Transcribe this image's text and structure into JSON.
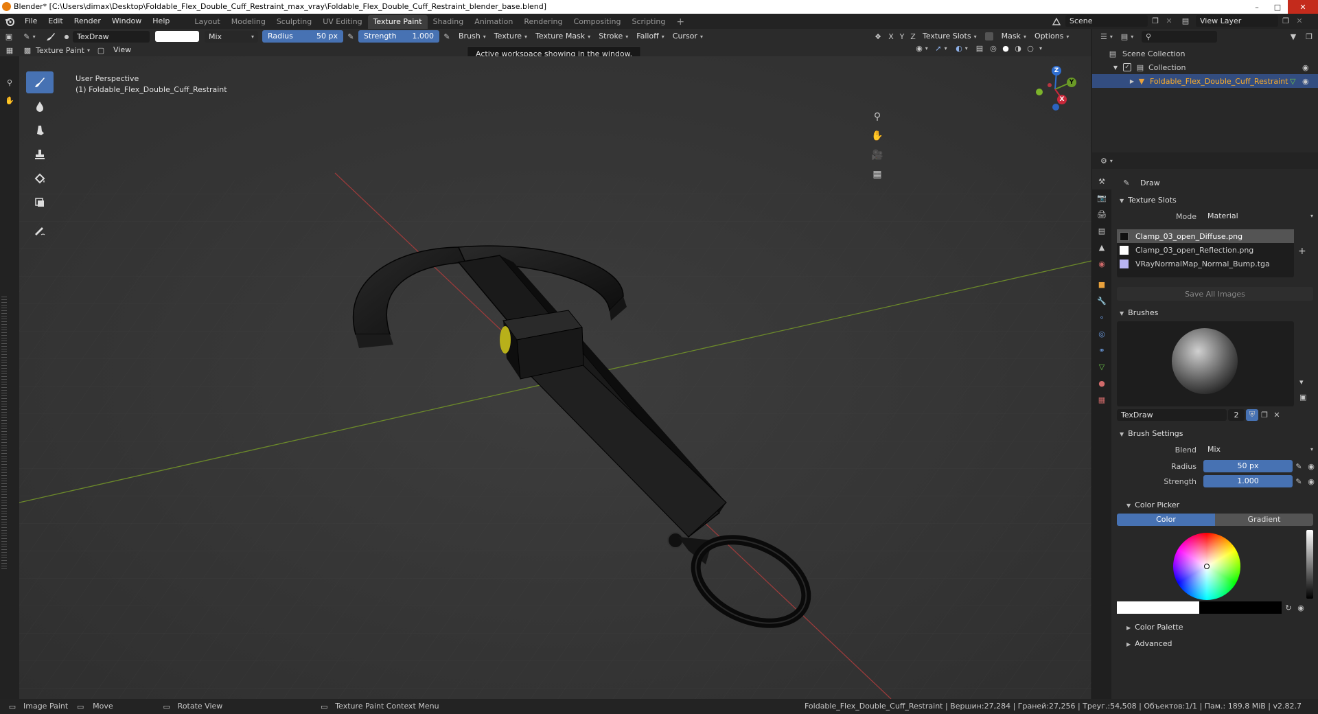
{
  "titlebar": {
    "title": "Blender* [C:\\Users\\dimax\\Desktop\\Foldable_Flex_Double_Cuff_Restraint_max_vray\\Foldable_Flex_Double_Cuff_Restraint_blender_base.blend]"
  },
  "menubar": {
    "menus": [
      "File",
      "Edit",
      "Render",
      "Window",
      "Help"
    ],
    "workspaces": [
      "Layout",
      "Modeling",
      "Sculpting",
      "UV Editing",
      "Texture Paint",
      "Shading",
      "Animation",
      "Rendering",
      "Compositing",
      "Scripting"
    ],
    "active_workspace": "Texture Paint",
    "scene_label": "Scene",
    "view_layer_label": "View Layer"
  },
  "toolheader": {
    "brush_name": "TexDraw",
    "blend_mode": "Mix",
    "radius_label": "Radius",
    "radius_value": "50 px",
    "strength_label": "Strength",
    "strength_value": "1.000",
    "brush_label": "Brush",
    "texture_label": "Texture",
    "texture_mask_label": "Texture Mask",
    "stroke_label": "Stroke",
    "falloff_label": "Falloff",
    "cursor_label": "Cursor",
    "axis_x": "X",
    "axis_y": "Y",
    "axis_z": "Z",
    "texture_slots_label": "Texture Slots",
    "mask_label": "Mask",
    "options_label": "Options",
    "mode_label": "Texture Paint",
    "view_label": "View"
  },
  "tooltip": "Active workspace showing in the window.",
  "viewport": {
    "perspective": "User Perspective",
    "object_label": "(1) Foldable_Flex_Double_Cuff_Restraint",
    "gizmo": {
      "x": "X",
      "y": "Y",
      "z": "Z"
    }
  },
  "outliner": {
    "scene_collection": "Scene Collection",
    "collection": "Collection",
    "object": "Foldable_Flex_Double_Cuff_Restraint"
  },
  "properties": {
    "tool_name": "Draw",
    "texture_slots_header": "Texture Slots",
    "mode_label": "Mode",
    "mode_value": "Material",
    "slots": [
      "Clamp_03_open_Diffuse.png",
      "Clamp_03_open_Reflection.png",
      "VRayNormalMap_Normal_Bump.tga"
    ],
    "save_all_images": "Save All Images",
    "brushes_header": "Brushes",
    "brush_name": "TexDraw",
    "brush_users": "2",
    "brush_settings_header": "Brush Settings",
    "blend_label": "Blend",
    "blend_value": "Mix",
    "radius_label": "Radius",
    "radius_value": "50 px",
    "strength_label": "Strength",
    "strength_value": "1.000",
    "color_picker_header": "Color Picker",
    "color_tab": "Color",
    "gradient_tab": "Gradient",
    "color_palette_header": "Color Palette",
    "advanced_header": "Advanced"
  },
  "statusbar": {
    "image_paint": "Image Paint",
    "move": "Move",
    "rotate_view": "Rotate View",
    "context_menu": "Texture Paint Context Menu",
    "stats": "Foldable_Flex_Double_Cuff_Restraint | Вершин:27,284 | Граней:27,256 | Треуг.:54,508 | Объектов:1/1 | Пам.: 189.8 MiB | v2.82.7"
  },
  "colors": {
    "accent_blue": "#4772b3",
    "active_object_orange": "#e8a13c",
    "title_logo": "#e87d0d",
    "grid_red": "#9c3b3b",
    "grid_green": "#6c8a2a"
  }
}
